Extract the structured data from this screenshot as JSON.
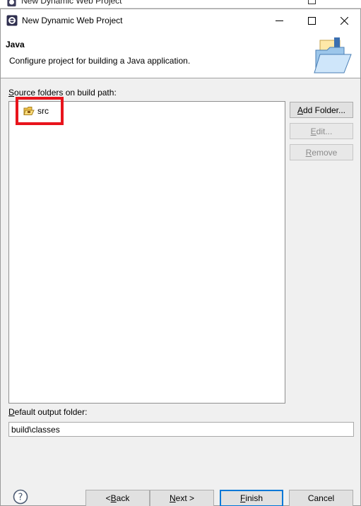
{
  "background_window": {
    "title": "New Dynamic Web Project"
  },
  "window": {
    "title": "New Dynamic Web Project",
    "controls": {
      "minimize": "minimize",
      "maximize": "maximize",
      "close": "close"
    }
  },
  "banner": {
    "heading": "Java",
    "description": "Configure project for building a Java application."
  },
  "source_folders": {
    "label_mnemonic": "S",
    "label_rest": "ource folders on build path:",
    "items": [
      {
        "name": "src",
        "icon": "package-folder-icon"
      }
    ]
  },
  "buttons": {
    "add_folder_mn": "A",
    "add_folder_rest": "dd Folder...",
    "edit_mn": "E",
    "edit_rest": "dit...",
    "remove_mn": "R",
    "remove_rest": "emove"
  },
  "output": {
    "label_mnemonic": "D",
    "label_rest": "efault output folder:",
    "value": "build\\classes"
  },
  "footer": {
    "back_pre": "< ",
    "back_mn": "B",
    "back_rest": "ack",
    "next_mn": "N",
    "next_rest": "ext >",
    "finish_mn": "F",
    "finish_rest": "inish",
    "cancel": "Cancel"
  },
  "colors": {
    "highlight": "#e8141c",
    "default_button_border": "#0078d7",
    "dialog_background": "#f0f0f0"
  }
}
